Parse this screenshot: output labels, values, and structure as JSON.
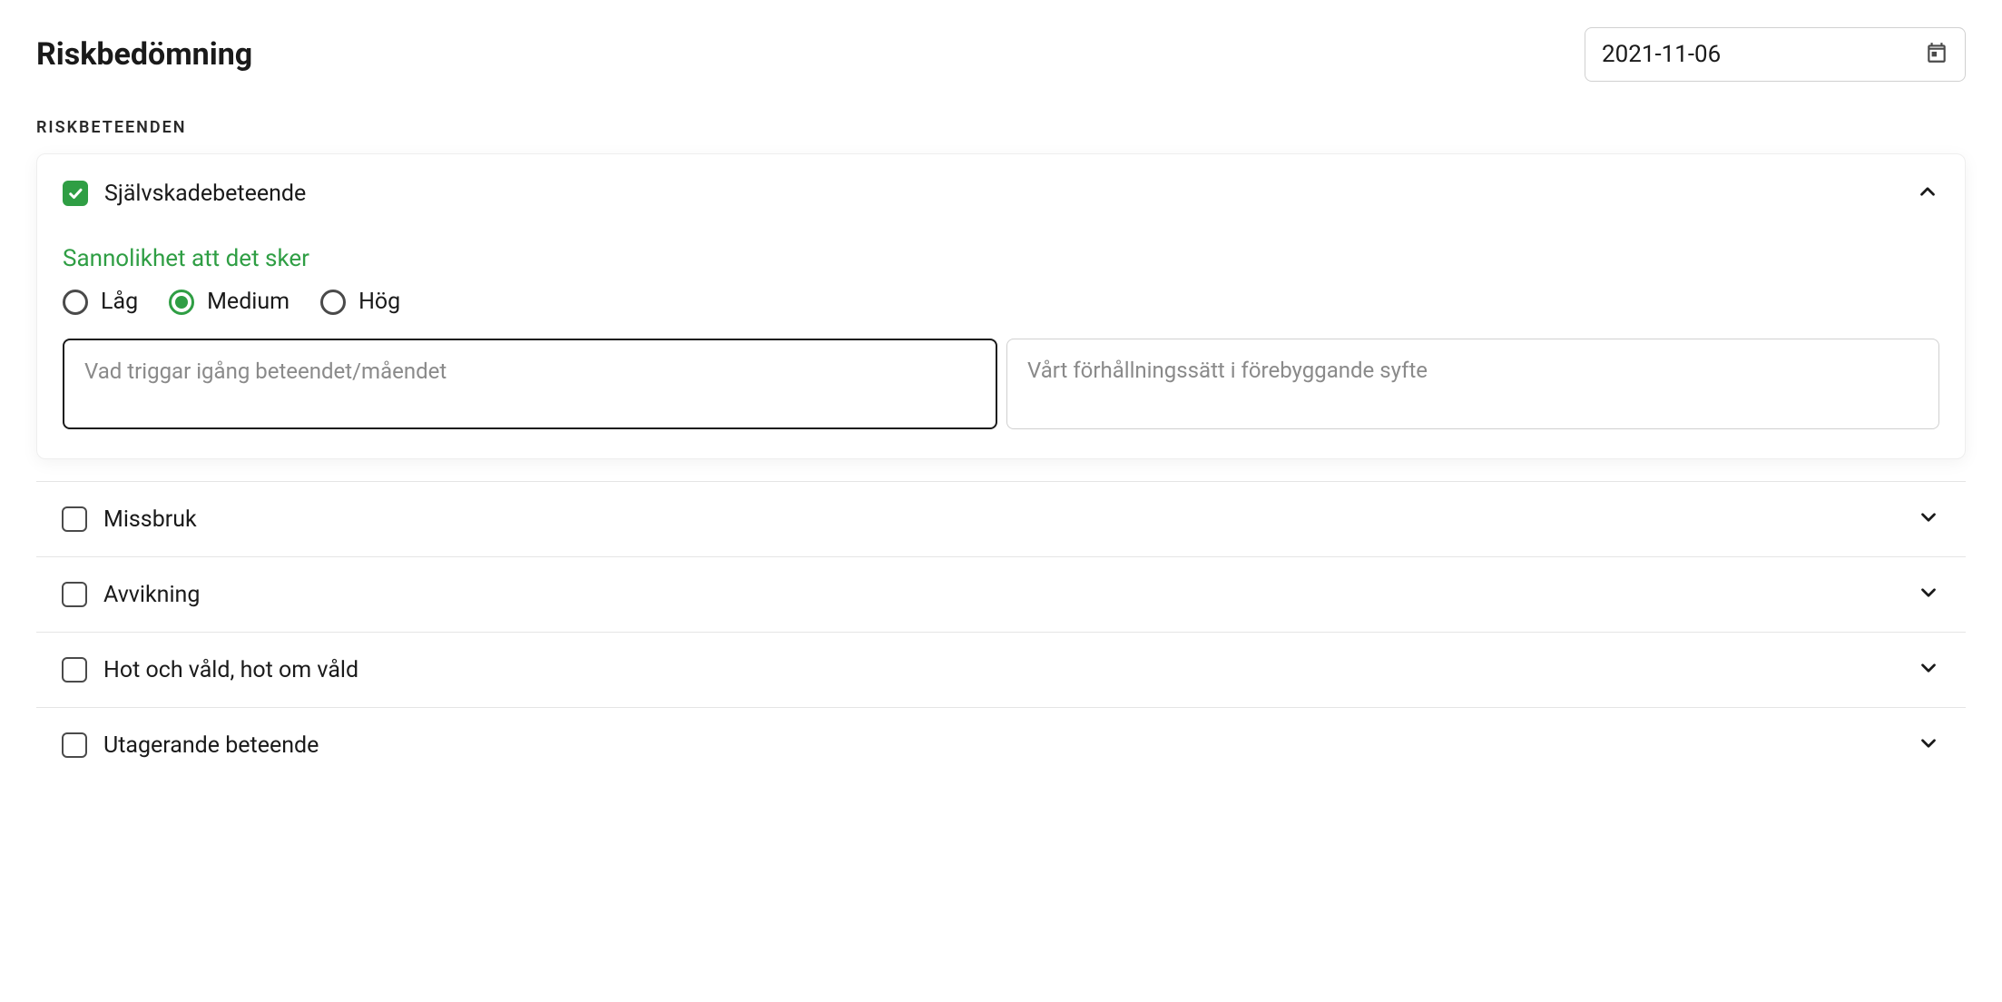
{
  "header": {
    "title": "Riskbedömning",
    "date": "2021-11-06"
  },
  "section_label": "RISKBETEENDEN",
  "expanded": {
    "checked": true,
    "label": "Självskadebeteende",
    "sub_title": "Sannolikhet att det sker",
    "radios": {
      "low": "Låg",
      "medium": "Medium",
      "high": "Hög",
      "selected": "medium"
    },
    "textarea_a_placeholder": "Vad triggar igång beteendet/måendet",
    "textarea_b_placeholder": "Vårt förhållningssätt i förebyggande syfte"
  },
  "rows": [
    {
      "label": "Missbruk"
    },
    {
      "label": "Avvikning"
    },
    {
      "label": "Hot och våld, hot om våld"
    },
    {
      "label": "Utagerande beteende"
    }
  ]
}
